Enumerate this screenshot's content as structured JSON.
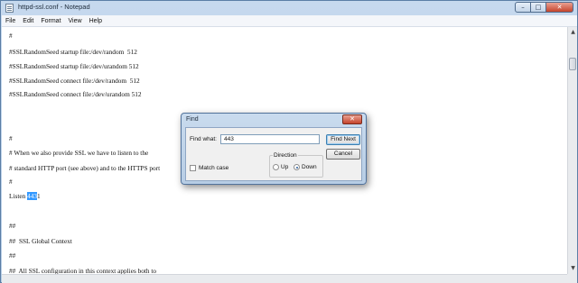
{
  "window": {
    "title": "httpd-ssl.conf - Notepad",
    "minimize_glyph": "–",
    "maximize_glyph": "□",
    "close_glyph": "✕"
  },
  "menu": [
    "File",
    "Edit",
    "Format",
    "View",
    "Help"
  ],
  "editor": {
    "lines": [
      "#",
      "#SSLRandomSeed startup file:/dev/random  512",
      "#SSLRandomSeed startup file:/dev/urandom 512",
      "#SSLRandomSeed connect file:/dev/random  512",
      "#SSLRandomSeed connect file:/dev/urandom 512",
      "",
      "",
      "#",
      "# When we also provide SSL we have to listen to the",
      "# standard HTTP port (see above) and to the HTTPS port",
      "#"
    ],
    "listen_prefix": "Listen ",
    "listen_selected": "443",
    "listen_suffix": "1",
    "lines_after": [
      "",
      "##",
      "##  SSL Global Context",
      "##",
      "##  All SSL configuration in this context applies both to"
    ]
  },
  "find_dialog": {
    "title": "Find",
    "close_glyph": "✕",
    "find_what_label": "Find what:",
    "find_what_value": "443",
    "find_next_label": "Find Next",
    "cancel_label": "Cancel",
    "direction_label": "Direction",
    "up_label": "Up",
    "down_label": "Down",
    "direction_selected": "Down",
    "match_case_label": "Match case",
    "match_case_checked": false
  },
  "icons": {
    "scroll_up": "▲",
    "scroll_down": "▼"
  }
}
